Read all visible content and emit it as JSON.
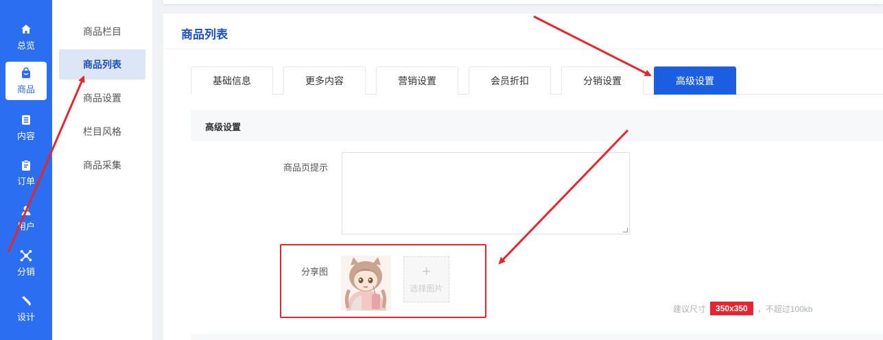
{
  "rail": {
    "items": [
      {
        "label": "总览",
        "icon": "home-icon"
      },
      {
        "label": "商品",
        "icon": "bag-icon"
      },
      {
        "label": "内容",
        "icon": "list-icon"
      },
      {
        "label": "订单",
        "icon": "clipboard-icon"
      },
      {
        "label": "用户",
        "icon": "user-icon"
      },
      {
        "label": "分销",
        "icon": "network-icon"
      },
      {
        "label": "设计",
        "icon": "brush-icon"
      }
    ],
    "active_index": 1
  },
  "submenu": {
    "items": [
      "商品栏目",
      "商品列表",
      "商品设置",
      "栏目风格",
      "商品采集"
    ],
    "active_index": 1
  },
  "page": {
    "title": "商品列表"
  },
  "tabs": {
    "items": [
      "基础信息",
      "更多内容",
      "营销设置",
      "会员折扣",
      "分销设置",
      "高级设置"
    ],
    "active_index": 5
  },
  "section": {
    "title": "高级设置"
  },
  "form": {
    "tip_label": "商品页提示",
    "tip_value": "",
    "share_label": "分享图",
    "add_image_plus": "+",
    "add_image_label": "选择图片",
    "size_hint_prefix": "建议尺寸",
    "size_hint_value": "350x350",
    "size_hint_suffix": "，不超过100kb"
  },
  "colors": {
    "rail_bg": "#2b6ef0",
    "accent": "#1b5fe0",
    "annotation": "#e8242e"
  }
}
